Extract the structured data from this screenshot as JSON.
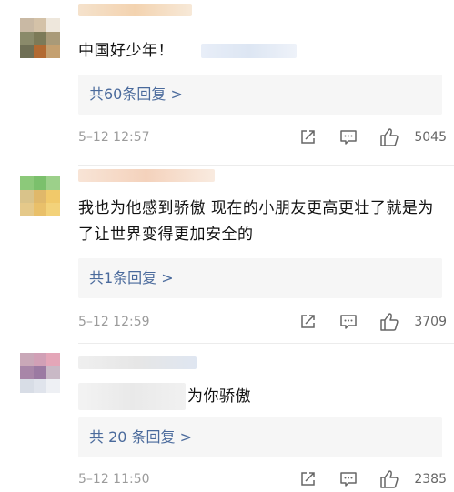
{
  "comments": [
    {
      "text": "中国好少年！",
      "replies_label": "共60条回复 >",
      "timestamp": "5–12 12:57",
      "likes": "5045"
    },
    {
      "text": "我也为他感到骄傲 现在的小朋友更高更壮了就是为了让世界变得更加安全的",
      "replies_label": "共1条回复 >",
      "timestamp": "5–12 12:59",
      "likes": "3709"
    },
    {
      "text": "为你骄傲",
      "replies_label": "共 20 条回复 >",
      "timestamp": "5–12 11:50",
      "likes": "2385"
    }
  ],
  "icons": [
    "share-icon",
    "comment-icon",
    "like-icon"
  ],
  "colors": {
    "link": "#4a6a9c",
    "meta": "#9b9b9b",
    "reply_bg": "#f6f6f6"
  }
}
